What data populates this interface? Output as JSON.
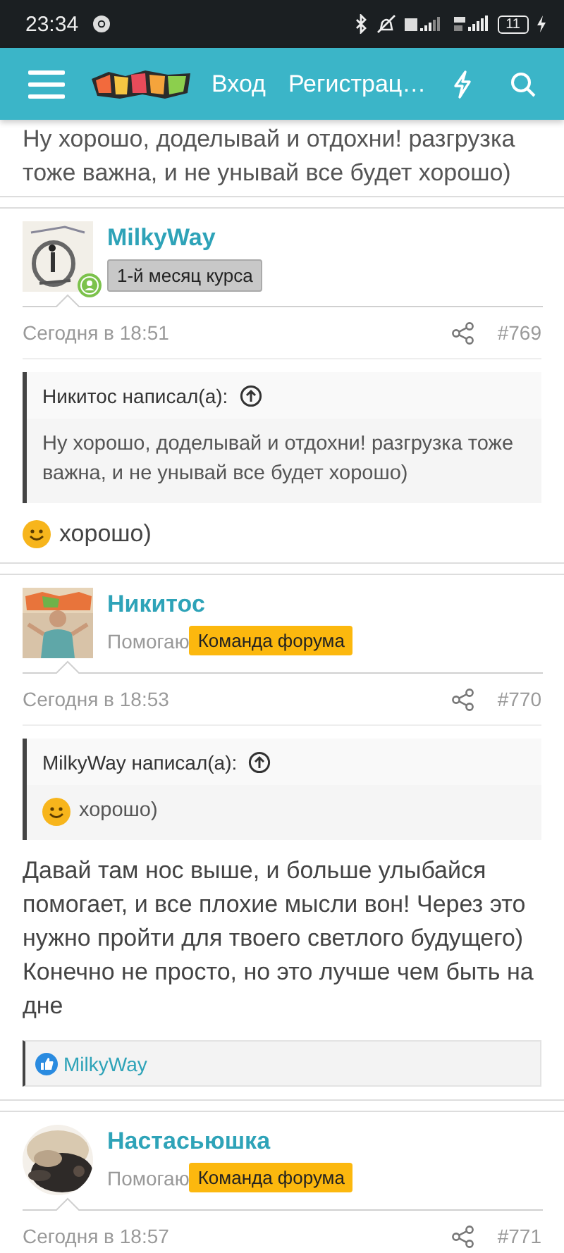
{
  "status_bar": {
    "time": "23:34",
    "battery": "11"
  },
  "header": {
    "nav": [
      {
        "label": "Вход"
      },
      {
        "label": "Регистрац…"
      }
    ]
  },
  "top_fragment": "Ну хорошо, доделывай и отдохни! разгрузка тоже важна, и не унывай все будет хорошо)",
  "posts": [
    {
      "author": "MilkyWay",
      "avatar": {
        "kind": "picture",
        "round": false
      },
      "online": true,
      "badges": [
        {
          "kind": "rank",
          "text": "1-й месяц курса"
        }
      ],
      "date": "Сегодня в 18:51",
      "number": "#769",
      "quote": {
        "header": "Никитос написал(а):",
        "body": [
          {
            "kind": "text",
            "text": "Ну хорошо, доделывай и отдохни! разгрузка тоже важна, и не унывай все будет хорошо)"
          }
        ]
      },
      "body": [
        {
          "kind": "smiley"
        },
        {
          "kind": "text",
          "text": "хорошо)"
        }
      ]
    },
    {
      "author": "Никитос",
      "avatar": {
        "kind": "picture",
        "round": false
      },
      "online": false,
      "badges": [
        {
          "kind": "title",
          "text": "Помогаю"
        },
        {
          "kind": "team",
          "text": "Команда форума"
        }
      ],
      "date": "Сегодня в 18:53",
      "number": "#770",
      "quote": {
        "header": "MilkyWay написал(а):",
        "body": [
          {
            "kind": "smiley"
          },
          {
            "kind": "text",
            "text": "хорошо)"
          }
        ]
      },
      "body": [
        {
          "kind": "text",
          "text": "Давай там нос выше, и больше улыбайся помогает, и все плохие мысли вон! Через это нужно пройти для твоего светлого будущего) Конечно не просто, но это лучше чем быть на дне"
        }
      ],
      "likes": [
        "MilkyWay"
      ]
    },
    {
      "author": "Настасьюшка",
      "avatar": {
        "kind": "picture",
        "round": true
      },
      "online": false,
      "badges": [
        {
          "kind": "title",
          "text": "Помогаю"
        },
        {
          "kind": "team",
          "text": "Команда форума"
        }
      ],
      "date": "Сегодня в 18:57",
      "number": "#771"
    }
  ]
}
